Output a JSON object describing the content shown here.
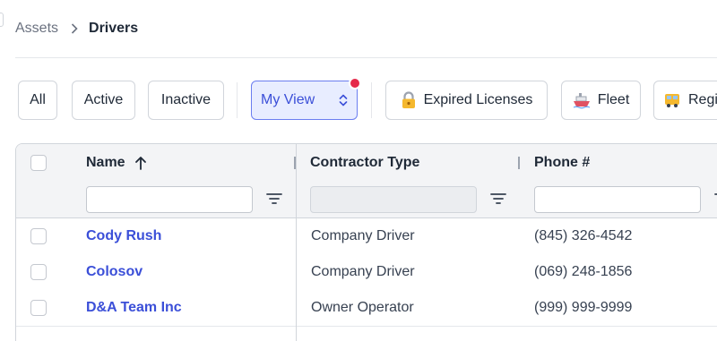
{
  "breadcrumb": {
    "parent": "Assets",
    "current": "Drivers"
  },
  "filters": {
    "all": "All",
    "active": "Active",
    "inactive": "Inactive",
    "my_view": "My View",
    "expired_licenses": "Expired Licenses",
    "fleet": "Fleet",
    "regional": "Regi"
  },
  "colors": {
    "accent": "#3b4fd8",
    "active_bg": "#e8edff",
    "notification": "#e5294a"
  },
  "icons": {
    "breadcrumb_sep": "chevron-right-icon",
    "sort": "arrow-up-icon",
    "my_view_toggle": "chevrons-up-down-icon",
    "expired_licenses": "lock-icon",
    "fleet": "ship-icon",
    "regional": "bus-icon",
    "column_filter": "filter-icon"
  },
  "table": {
    "columns": [
      {
        "label": "Name",
        "sorted": "ascending"
      },
      {
        "label": "Contractor Type"
      },
      {
        "label": "Phone #"
      }
    ],
    "rows": [
      {
        "name": "Cody Rush",
        "contractor_type": "Company Driver",
        "phone": "(845) 326-4542"
      },
      {
        "name": "Colosov",
        "contractor_type": "Company Driver",
        "phone": "(069) 248-1856"
      },
      {
        "name": "D&A Team Inc",
        "contractor_type": "Owner Operator",
        "phone": "(999) 999-9999"
      }
    ]
  }
}
